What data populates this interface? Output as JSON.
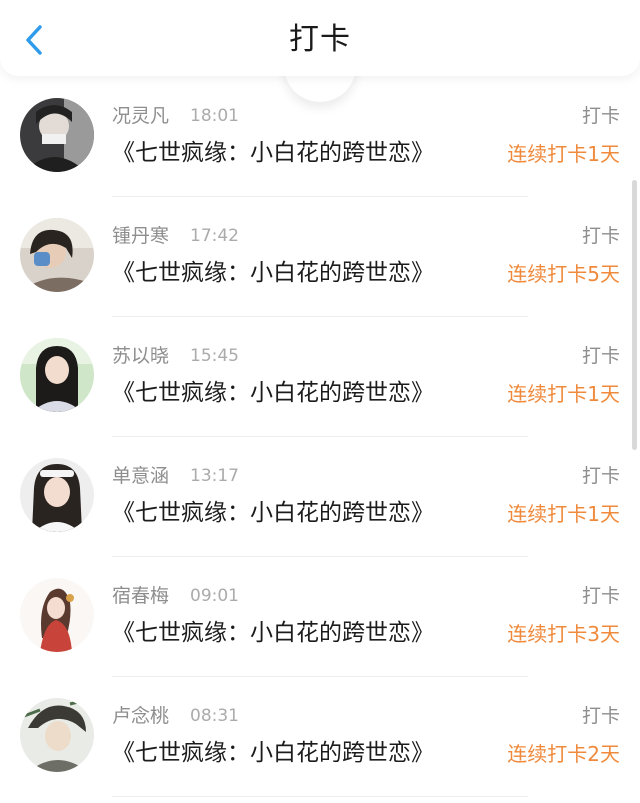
{
  "header": {
    "title": "打卡",
    "back_icon": "chevron-left-icon",
    "accent": "#2f9bea"
  },
  "colors": {
    "streak": "#ef8a3c",
    "secondary_text": "#8e8e8e",
    "primary_text": "#1c1c1c"
  },
  "entries": [
    {
      "name": "况灵凡",
      "time": "18:01",
      "book": "《七世疯缘：小白花的跨世恋》",
      "action": "打卡",
      "streak": "连续打卡1天"
    },
    {
      "name": "锺丹寒",
      "time": "17:42",
      "book": "《七世疯缘：小白花的跨世恋》",
      "action": "打卡",
      "streak": "连续打卡5天"
    },
    {
      "name": "苏以晓",
      "time": "15:45",
      "book": "《七世疯缘：小白花的跨世恋》",
      "action": "打卡",
      "streak": "连续打卡1天"
    },
    {
      "name": "单意涵",
      "time": "13:17",
      "book": "《七世疯缘：小白花的跨世恋》",
      "action": "打卡",
      "streak": "连续打卡1天"
    },
    {
      "name": "宿春梅",
      "time": "09:01",
      "book": "《七世疯缘：小白花的跨世恋》",
      "action": "打卡",
      "streak": "连续打卡3天"
    },
    {
      "name": "卢念桃",
      "time": "08:31",
      "book": "《七世疯缘：小白花的跨世恋》",
      "action": "打卡",
      "streak": "连续打卡2天"
    }
  ]
}
